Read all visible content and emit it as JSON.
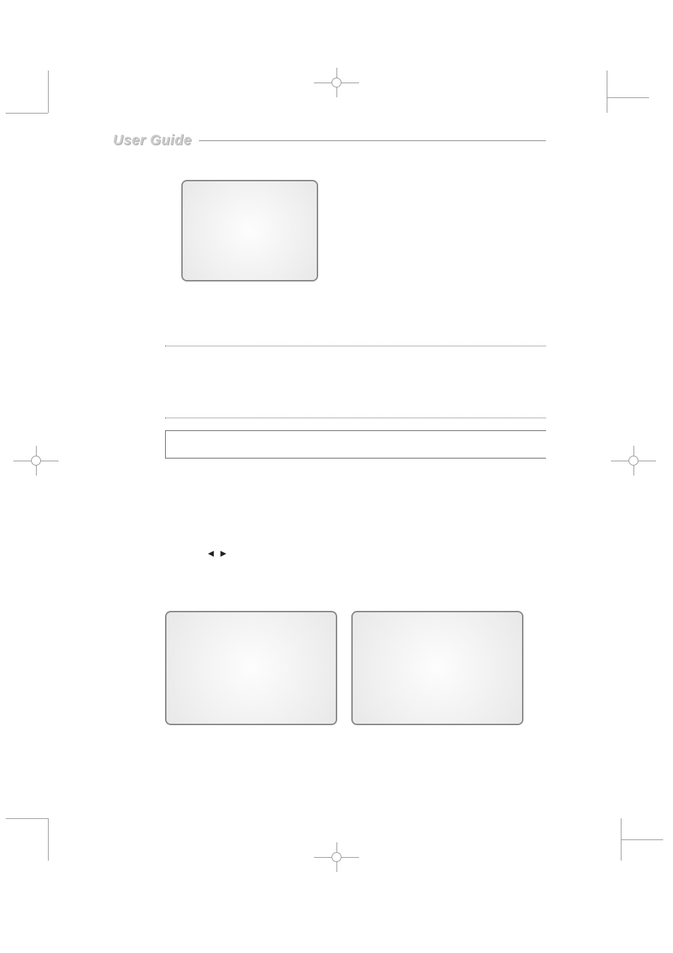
{
  "header": {
    "title": "User Guide"
  },
  "icons": {
    "arrow_left": "◄",
    "arrow_right": "►"
  }
}
